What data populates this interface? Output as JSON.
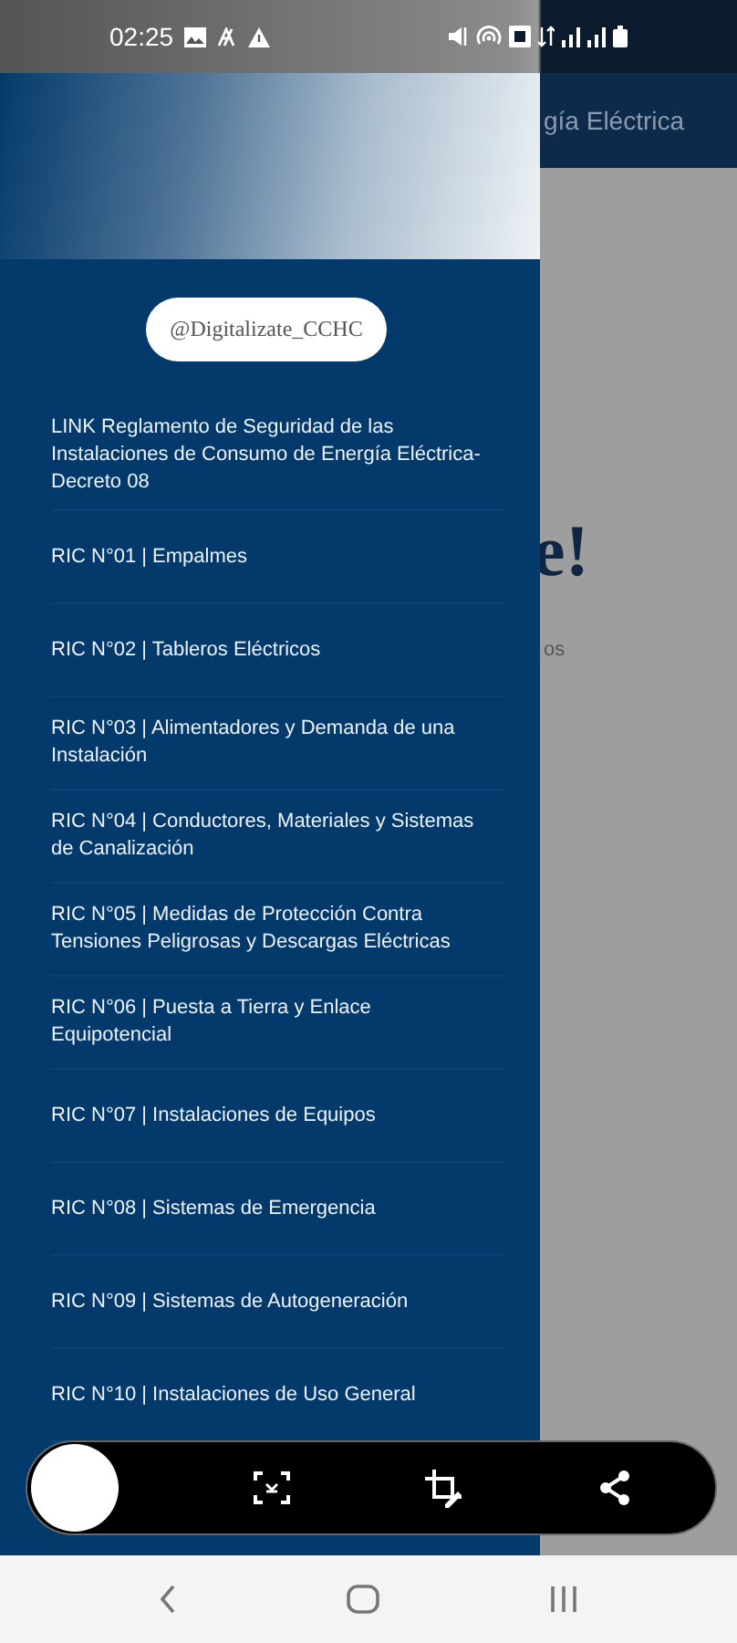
{
  "status_bar": {
    "time": "02:25"
  },
  "background_app": {
    "title": "gía Eléctrica",
    "heading": "e!",
    "text": "os"
  },
  "drawer": {
    "handle": "@Digitalizate_CCHC",
    "items": [
      {
        "label": "LINK Reglamento de Seguridad de las Instalaciones de Consumo de Energía Eléctrica- Decreto 08"
      },
      {
        "label": "RIC N°01 | Empalmes"
      },
      {
        "label": "RIC N°02 | Tableros Eléctricos"
      },
      {
        "label": "RIC N°03 | Alimentadores y Demanda de una Instalación"
      },
      {
        "label": "RIC N°04 | Conductores, Materiales y Sistemas de Canalización"
      },
      {
        "label": "RIC N°05 | Medidas de Protección Contra Tensiones Peligrosas y Descargas Eléctricas"
      },
      {
        "label": "RIC N°06 | Puesta a Tierra y Enlace Equipotencial"
      },
      {
        "label": "RIC N°07 | Instalaciones de Equipos"
      },
      {
        "label": "RIC N°08 | Sistemas de Emergencia"
      },
      {
        "label": "RIC N°09 | Sistemas de Autogeneración"
      },
      {
        "label": "RIC N°10 | Instalaciones de Uso General"
      }
    ]
  }
}
